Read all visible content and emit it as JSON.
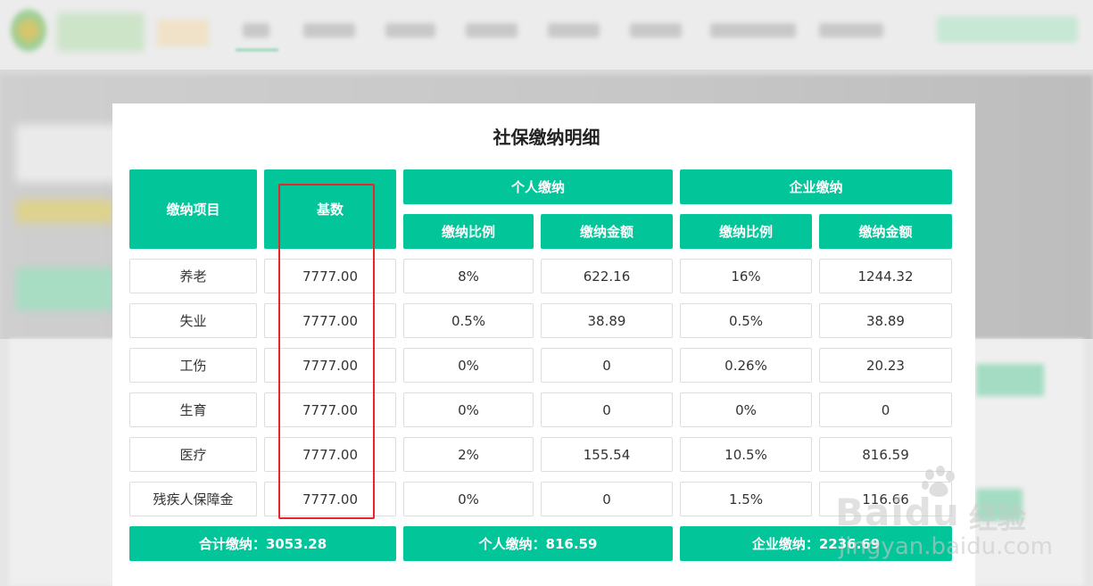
{
  "modal": {
    "title": "社保缴纳明细"
  },
  "table": {
    "headers": {
      "item": "缴纳项目",
      "base": "基数",
      "personal": "个人缴纳",
      "company": "企业缴纳",
      "rate": "缴纳比例",
      "amount": "缴纳金额"
    },
    "rows": [
      {
        "item": "养老",
        "base": "7777.00",
        "p_rate": "8%",
        "p_amount": "622.16",
        "c_rate": "16%",
        "c_amount": "1244.32"
      },
      {
        "item": "失业",
        "base": "7777.00",
        "p_rate": "0.5%",
        "p_amount": "38.89",
        "c_rate": "0.5%",
        "c_amount": "38.89"
      },
      {
        "item": "工伤",
        "base": "7777.00",
        "p_rate": "0%",
        "p_amount": "0",
        "c_rate": "0.26%",
        "c_amount": "20.23"
      },
      {
        "item": "生育",
        "base": "7777.00",
        "p_rate": "0%",
        "p_amount": "0",
        "c_rate": "0%",
        "c_amount": "0"
      },
      {
        "item": "医疗",
        "base": "7777.00",
        "p_rate": "2%",
        "p_amount": "155.54",
        "c_rate": "10.5%",
        "c_amount": "816.59"
      },
      {
        "item": "残疾人保障金",
        "base": "7777.00",
        "p_rate": "0%",
        "p_amount": "0",
        "c_rate": "1.5%",
        "c_amount": "116.66"
      }
    ]
  },
  "totals": {
    "all": "合计缴纳：3053.28",
    "personal": "个人缴纳：816.59",
    "company": "企业缴纳：2236.69"
  },
  "watermark": {
    "brand": "Bai",
    "brand2": "du",
    "product": "经验",
    "url": "jingyan.baidu.com"
  },
  "colors": {
    "accent": "#02c59a",
    "highlight": "#e6262b"
  }
}
